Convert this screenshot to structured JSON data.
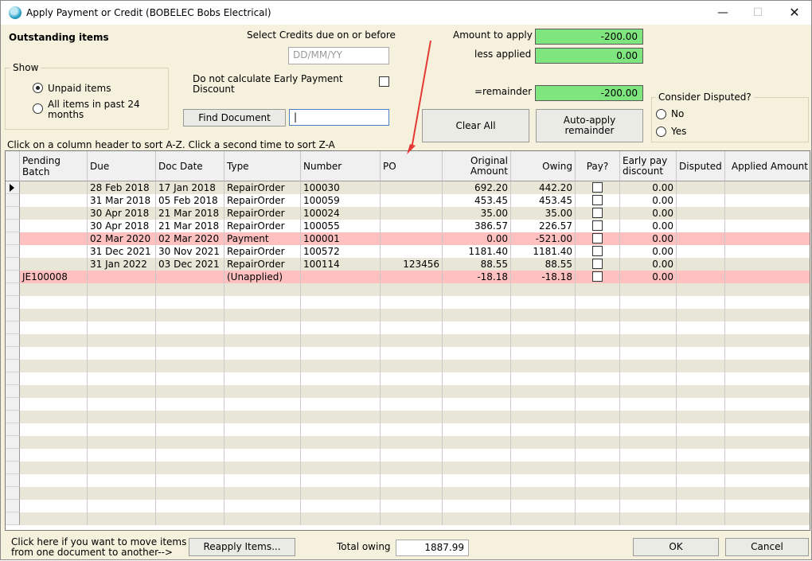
{
  "window": {
    "title": "Apply Payment or Credit  (BOBELEC Bobs Electrical)",
    "controls": {
      "minimize": "—",
      "maximize": "☐",
      "close": "✕"
    }
  },
  "outstanding_heading": "Outstanding items",
  "credits": {
    "label": "Select Credits due on or before",
    "date_placeholder": "DD/MM/YY"
  },
  "show": {
    "title": "Show",
    "options": [
      {
        "label": "Unpaid items",
        "checked": true
      },
      {
        "label": "All items in past 24 months",
        "line1": "All items in past 24",
        "line2": "months",
        "checked": false
      }
    ]
  },
  "early_payment": {
    "line1": "Do not calculate Early Payment",
    "line2": "Discount",
    "checked": false
  },
  "find": {
    "button": "Find Document",
    "value": ""
  },
  "amounts": {
    "amount_to_apply_label": "Amount to apply",
    "amount_to_apply": "-200.00",
    "less_applied_label": "less applied",
    "less_applied": "0.00",
    "remainder_label": "=remainder",
    "remainder": "-200.00"
  },
  "buttons": {
    "clear_all": "Clear All",
    "auto_apply_line1": "Auto-apply",
    "auto_apply_line2": "remainder",
    "reapply": "Reapply Items...",
    "ok": "OK",
    "cancel": "Cancel"
  },
  "disputed": {
    "title": "Consider Disputed?",
    "options": [
      {
        "label": "No",
        "checked": false
      },
      {
        "label": "Yes",
        "checked": false
      }
    ]
  },
  "sort_hint": "Click on a column header to sort A-Z.  Click a second time to sort Z-A",
  "grid": {
    "columns": [
      {
        "label": "Pending Batch"
      },
      {
        "label": "Due"
      },
      {
        "label": "Doc Date"
      },
      {
        "label": "Type"
      },
      {
        "label": "Number"
      },
      {
        "label": "PO"
      },
      {
        "label": "Original Amount",
        "line1": "Original",
        "line2": "Amount"
      },
      {
        "label": "Owing"
      },
      {
        "label": "Pay?"
      },
      {
        "label": "Early pay discount",
        "line1": "Early pay",
        "line2": "discount"
      },
      {
        "label": "Disputed"
      },
      {
        "label": "Applied Amount"
      }
    ],
    "rows": [
      {
        "batch": "",
        "due": "28 Feb 2018",
        "doc_date": "17 Jan 2018",
        "type": "RepairOrder",
        "number": "100030",
        "po": "",
        "original": "692.20",
        "owing": "442.20",
        "pay": false,
        "early": "0.00",
        "disputed": "",
        "applied": "",
        "status": "normal",
        "current": true
      },
      {
        "batch": "",
        "due": "31 Mar 2018",
        "doc_date": "05 Feb 2018",
        "type": "RepairOrder",
        "number": "100059",
        "po": "",
        "original": "453.45",
        "owing": "453.45",
        "pay": false,
        "early": "0.00",
        "disputed": "",
        "applied": "",
        "status": "normal"
      },
      {
        "batch": "",
        "due": "30 Apr 2018",
        "doc_date": "21 Mar 2018",
        "type": "RepairOrder",
        "number": "100024",
        "po": "",
        "original": "35.00",
        "owing": "35.00",
        "pay": false,
        "early": "0.00",
        "disputed": "",
        "applied": "",
        "status": "normal"
      },
      {
        "batch": "",
        "due": "30 Apr 2018",
        "doc_date": "21 Mar 2018",
        "type": "RepairOrder",
        "number": "100055",
        "po": "",
        "original": "386.57",
        "owing": "226.57",
        "pay": false,
        "early": "0.00",
        "disputed": "",
        "applied": "",
        "status": "normal"
      },
      {
        "batch": "",
        "due": "02 Mar 2020",
        "doc_date": "02 Mar 2020",
        "type": "Payment",
        "number": "100001",
        "po": "",
        "original": "0.00",
        "owing": "-521.00",
        "pay": false,
        "early": "0.00",
        "disputed": "",
        "applied": "",
        "status": "highlight"
      },
      {
        "batch": "",
        "due": "31 Dec 2021",
        "doc_date": "30 Nov 2021",
        "type": "RepairOrder",
        "number": "100572",
        "po": "",
        "original": "1181.40",
        "owing": "1181.40",
        "pay": false,
        "early": "0.00",
        "disputed": "",
        "applied": "",
        "status": "normal"
      },
      {
        "batch": "",
        "due": "31 Jan 2022",
        "doc_date": "03 Dec 2021",
        "type": "RepairOrder",
        "number": "100114",
        "po": "123456",
        "original": "88.55",
        "owing": "88.55",
        "pay": false,
        "early": "0.00",
        "disputed": "",
        "applied": "",
        "status": "normal"
      },
      {
        "batch": "JE100008",
        "due": "",
        "doc_date": "",
        "type": "(Unapplied)",
        "number": "",
        "po": "",
        "original": "-18.18",
        "owing": "-18.18",
        "pay": false,
        "early": "0.00",
        "disputed": "",
        "applied": "",
        "status": "highlight"
      }
    ]
  },
  "footer": {
    "move_hint_line1": "Click here if you want to move items",
    "move_hint_line2": "from one document to another-->",
    "total_owing_label": "Total owing",
    "total_owing": "1887.99"
  },
  "colors": {
    "background": "#f5f1dc",
    "green_field": "#7fe67f",
    "highlight_row": "#ffc0c0",
    "alt_row": "#e8e6d6",
    "annotation_arrow": "#e53935"
  }
}
